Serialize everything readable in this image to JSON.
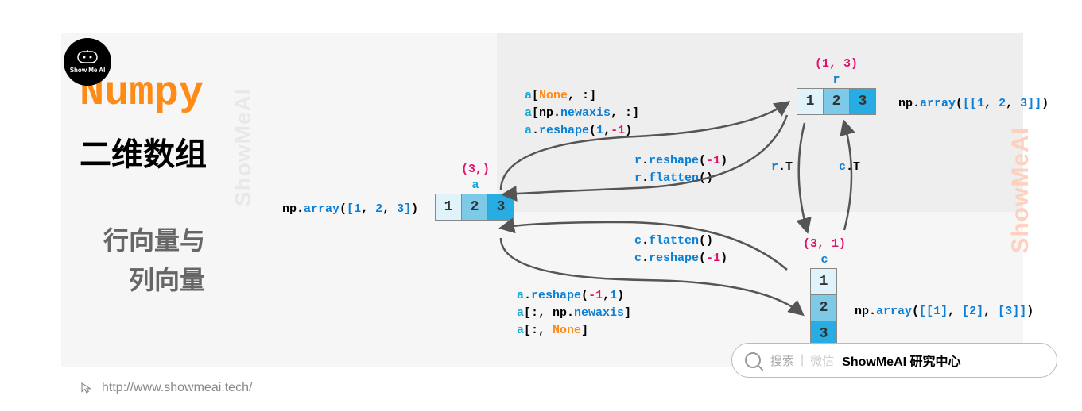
{
  "logo": {
    "face": "(^_^)",
    "text": "Show Me AI"
  },
  "titles": {
    "numpy": "Numpy",
    "sub": "二维数组",
    "row": "行向量与",
    "col": "列向量"
  },
  "url": "http://www.showmeai.tech/",
  "watermark": "ShowMeAI",
  "arrays": {
    "a": {
      "shape": "(3,)",
      "name": "a",
      "cells": [
        "1",
        "2",
        "3"
      ]
    },
    "r": {
      "shape": "(1, 3)",
      "name": "r",
      "cells": [
        "1",
        "2",
        "3"
      ]
    },
    "c": {
      "shape": "(3, 1)",
      "name": "c",
      "cells": [
        "1",
        "2",
        "3"
      ]
    }
  },
  "code": {
    "a_np": "np.array([1, 2, 3])",
    "r_np": "np.array([[1, 2, 3]])",
    "c_np": "np.array([[1], [2], [3]])",
    "a_to_r_1": "a[None, :]",
    "a_to_r_2": "a[np.newaxis, :]",
    "a_to_r_3": "a.reshape(1,-1)",
    "r_to_a_1": "r.reshape(-1)",
    "r_to_a_2": "r.flatten()",
    "rT": "r.T",
    "cT": "c.T",
    "c_to_a_1": "c.flatten()",
    "c_to_a_2": "c.reshape(-1)",
    "a_to_c_1": "a.reshape(-1,1)",
    "a_to_c_2": "a[:, np.newaxis]",
    "a_to_c_3": "a[:, None]"
  },
  "search": {
    "hint": "搜索",
    "wx": "微信",
    "main": "ShowMeAI 研究中心"
  }
}
